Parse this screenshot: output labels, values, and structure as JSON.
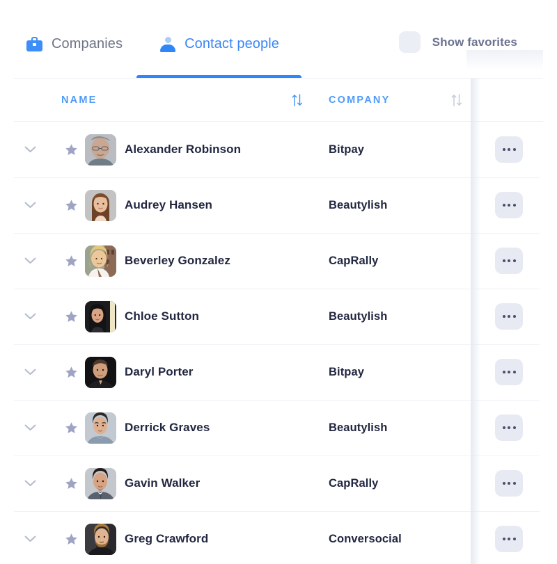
{
  "tabs": [
    {
      "label": "Companies",
      "icon": "briefcase-icon",
      "active": false
    },
    {
      "label": "Contact people",
      "icon": "person-icon",
      "active": true
    }
  ],
  "favorites": {
    "label": "Show favorites",
    "checked": false
  },
  "table": {
    "columns": [
      {
        "key": "name",
        "label": "NAME",
        "sortable": true,
        "sort_active": true
      },
      {
        "key": "company",
        "label": "COMPANY",
        "sortable": true,
        "sort_active": false
      }
    ],
    "row_action_label": "•••",
    "rows": [
      {
        "name": "Alexander Robinson",
        "company": "Bitpay",
        "favorite": false,
        "expanded": false,
        "avatar": "older-man-glasses"
      },
      {
        "name": "Audrey Hansen",
        "company": "Beautylish",
        "favorite": false,
        "expanded": false,
        "avatar": "young-woman-long-hair"
      },
      {
        "name": "Beverley Gonzalez",
        "company": "CapRally",
        "favorite": false,
        "expanded": false,
        "avatar": "blonde-woman-outdoors"
      },
      {
        "name": "Chloe Sutton",
        "company": "Beautylish",
        "favorite": false,
        "expanded": false,
        "avatar": "dark-hair-woman"
      },
      {
        "name": "Daryl Porter",
        "company": "Bitpay",
        "favorite": false,
        "expanded": false,
        "avatar": "man-dark-background"
      },
      {
        "name": "Derrick Graves",
        "company": "Beautylish",
        "favorite": false,
        "expanded": false,
        "avatar": "young-man-short-hair"
      },
      {
        "name": "Gavin Walker",
        "company": "CapRally",
        "favorite": false,
        "expanded": false,
        "avatar": "man-suit"
      },
      {
        "name": "Greg Crawford",
        "company": "Conversocial",
        "favorite": false,
        "expanded": false,
        "avatar": "bearded-man"
      }
    ]
  },
  "colors": {
    "accent": "#2e86f9",
    "tab_active_text": "#3b87f7",
    "tab_inactive_text": "#6f7487",
    "column_header": "#4e9bf9",
    "cell_text": "#222741",
    "star": "#9fa4c4",
    "more_button_bg": "#e7eaf3",
    "favorites_box_bg": "#eceef5",
    "divider": "#f0f2f7"
  }
}
